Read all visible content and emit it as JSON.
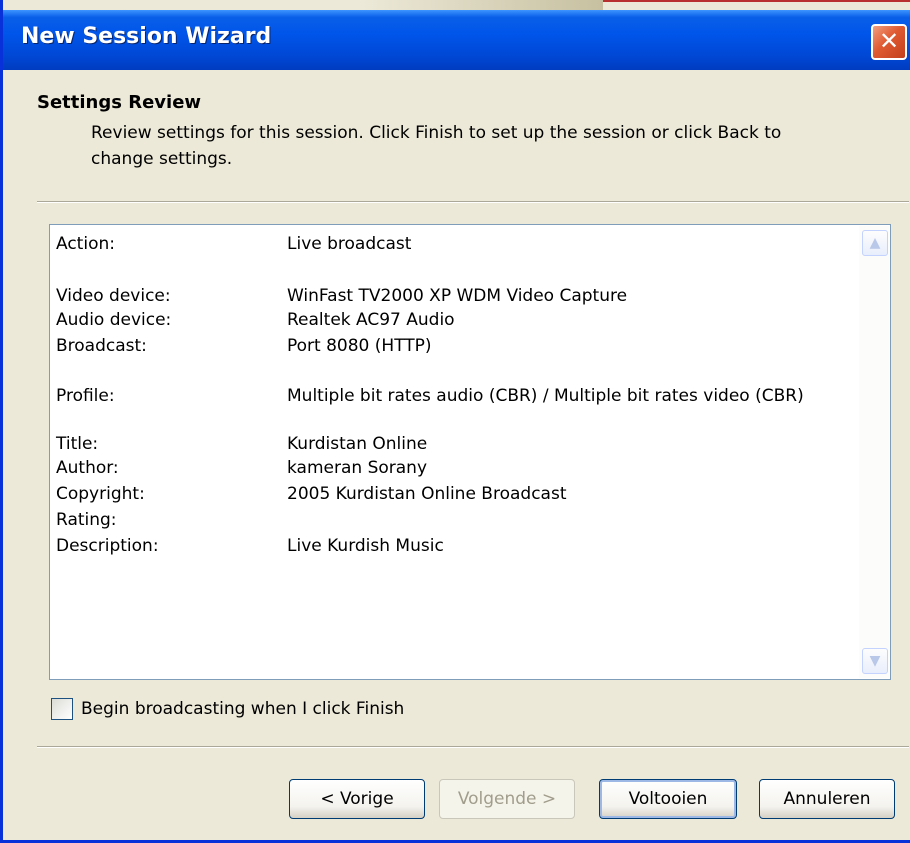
{
  "window": {
    "title": "New Session Wizard",
    "close_glyph": "✕"
  },
  "header": {
    "title": "Settings Review",
    "description_line1": "Review settings for this session. Click Finish to set up the session or click Back to",
    "description_line2": "change settings."
  },
  "review": {
    "rows": [
      {
        "label": "Action:",
        "value": "Live broadcast"
      },
      {
        "label": "Video device:",
        "value": "WinFast TV2000 XP WDM Video Capture"
      },
      {
        "label": "Audio device:",
        "value": "Realtek AC97 Audio"
      },
      {
        "label": "Broadcast:",
        "value": "Port 8080 (HTTP)"
      },
      {
        "label": "Profile:",
        "value": "Multiple bit rates audio (CBR) / Multiple bit rates video (CBR)"
      },
      {
        "label": "Title:",
        "value": "Kurdistan Online"
      },
      {
        "label": "Author:",
        "value": "kameran Sorany"
      },
      {
        "label": "Copyright:",
        "value": "2005 Kurdistan Online Broadcast"
      },
      {
        "label": "Rating:",
        "value": ""
      },
      {
        "label": "Description:",
        "value": "Live Kurdish Music"
      }
    ]
  },
  "checkbox": {
    "label": "Begin broadcasting when I click Finish",
    "checked": false
  },
  "buttons": {
    "back": "< Vorige",
    "next": "Volgende >",
    "finish": "Voltooien",
    "cancel": "Annuleren"
  },
  "icons": {
    "close": "close-icon",
    "scroll_up": "scroll-up-arrow-icon",
    "scroll_down": "scroll-down-arrow-icon"
  },
  "colors": {
    "titlebar": "#0055ea",
    "window_bg": "#ece9d8",
    "close_button": "#e05a30"
  }
}
